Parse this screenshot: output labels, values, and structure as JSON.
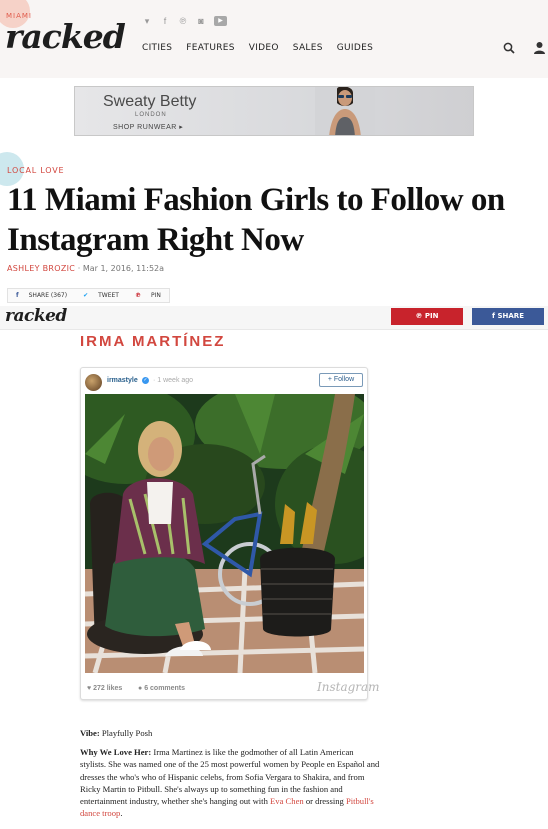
{
  "header": {
    "city": "MIAMI",
    "logo": "racked",
    "social_icons": [
      "vine-icon",
      "facebook-icon",
      "pinterest-icon",
      "instagram-icon",
      "youtube-icon"
    ],
    "nav": [
      "CITIES",
      "FEATURES",
      "VIDEO",
      "SALES",
      "GUIDES"
    ]
  },
  "ad": {
    "brand": "Sweaty Betty",
    "sub": "LONDON",
    "cta": "SHOP RUNWEAR ▸"
  },
  "article": {
    "section": "LOCAL LOVE",
    "headline": "11 Miami Fashion Girls to Follow on Instagram Right Now",
    "author": "ASHLEY BROZIC",
    "separator": "·",
    "date": "Mar 1, 2016, 11:52a",
    "share": {
      "facebook_label": "SHARE (367)",
      "twitter_label": "TWEET",
      "pinterest_label": "PIN"
    }
  },
  "sticky_bar": {
    "logo": "racked",
    "pin_label": "PIN",
    "share_label": "SHARE"
  },
  "subject": {
    "name": "IRMA MARTÍNEZ"
  },
  "instagram": {
    "username": "irmastyle",
    "time": "· 1 week ago",
    "follow_label": "+ Follow",
    "likes": "272 likes",
    "comments": "6 comments",
    "wordmark": "Instagram"
  },
  "copy": {
    "vibe_label": "Vibe:",
    "vibe_value": "Playfully Posh",
    "why_label": "Why We Love Her:",
    "why_text": "Irma Martinez is like the godmother of all Latin American stylists. She was named one of the 25 most powerful women by People en Español and dresses the who's who of Hispanic celebs, from Sofia Vergara to Shakira, and from Ricky Martin to Pitbull. She's always up to something fun in the fashion and entertainment industry, whether she's hanging out with",
    "link_1": "Eva Chen",
    "connector": "or dressing",
    "link_2": "Pitbull's dance troop",
    "end": "."
  },
  "colors": {
    "accent": "#d2473f",
    "pinterest": "#c8232c",
    "facebook": "#3b5998",
    "header_bg": "#f8f5f4"
  }
}
